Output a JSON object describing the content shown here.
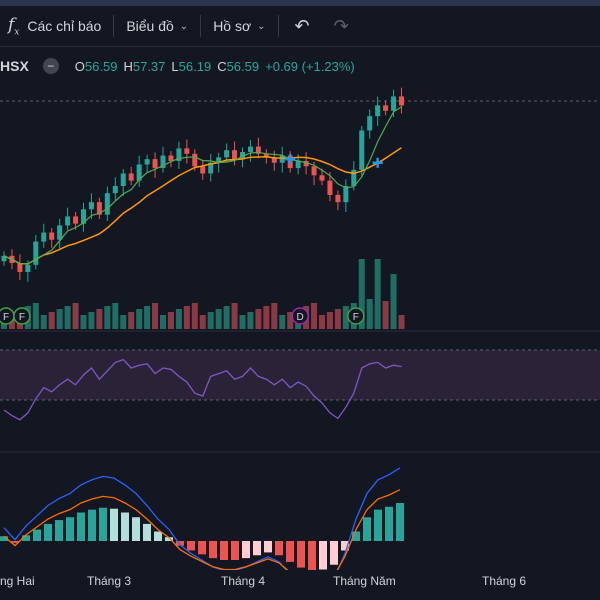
{
  "toolbar": {
    "indicators_label": "Các chỉ báo",
    "chart_label": "Biểu đồ",
    "profile_label": "Hồ sơ"
  },
  "legend": {
    "symbol": "HSX",
    "open_label": "O",
    "open": "56.59",
    "high_label": "H",
    "high": "57.37",
    "low_label": "L",
    "low": "56.19",
    "close_label": "C",
    "close": "56.59",
    "change": "+0.69 (+1.23%)"
  },
  "xaxis": [
    "ng Hai",
    "Tháng 3",
    "Tháng 4",
    "Tháng Năm",
    "Tháng 6"
  ],
  "markers": {
    "f": "F",
    "d": "D"
  },
  "colors": {
    "up": "#26a69a",
    "down": "#ef5350",
    "ma_fast": "#4caf50",
    "ma_slow": "#ff9800",
    "rsi": "#7e57c2",
    "macd": "#2962ff",
    "signal": "#ff6d00",
    "cross": "#2196f3"
  },
  "chart_data": {
    "type": "candlestick",
    "closes": [
      53.0,
      52.6,
      52.1,
      52.5,
      53.8,
      54.3,
      53.9,
      54.7,
      55.2,
      54.8,
      55.6,
      56.0,
      55.3,
      56.5,
      56.9,
      57.6,
      57.2,
      58.1,
      58.4,
      57.9,
      58.6,
      58.3,
      59.0,
      58.7,
      58.0,
      57.6,
      58.2,
      58.5,
      58.9,
      58.4,
      58.8,
      59.1,
      58.7,
      58.5,
      58.2,
      58.6,
      57.9,
      58.3,
      58.0,
      57.5,
      57.2,
      56.4,
      56.0,
      56.9,
      57.8,
      60.0,
      60.8,
      61.4,
      61.1,
      61.9,
      61.4
    ],
    "rsi": [
      40,
      36,
      33,
      38,
      48,
      56,
      53,
      58,
      62,
      58,
      65,
      70,
      62,
      68,
      74,
      76,
      70,
      72,
      73,
      66,
      70,
      69,
      64,
      60,
      52,
      50,
      64,
      66,
      68,
      62,
      64,
      70,
      64,
      62,
      58,
      62,
      56,
      60,
      57,
      50,
      45,
      38,
      34,
      42,
      52,
      70,
      73,
      74,
      70,
      72,
      71
    ],
    "macd_hist": [
      0.05,
      -0.02,
      0.06,
      0.12,
      0.18,
      0.22,
      0.25,
      0.3,
      0.33,
      0.35,
      0.34,
      0.3,
      0.25,
      0.18,
      0.1,
      0.04,
      -0.05,
      -0.1,
      -0.14,
      -0.18,
      -0.2,
      -0.2,
      -0.18,
      -0.15,
      -0.12,
      -0.15,
      -0.22,
      -0.28,
      -0.32,
      -0.3,
      -0.25,
      -0.1,
      0.1,
      0.25,
      0.33,
      0.36,
      0.4
    ]
  }
}
